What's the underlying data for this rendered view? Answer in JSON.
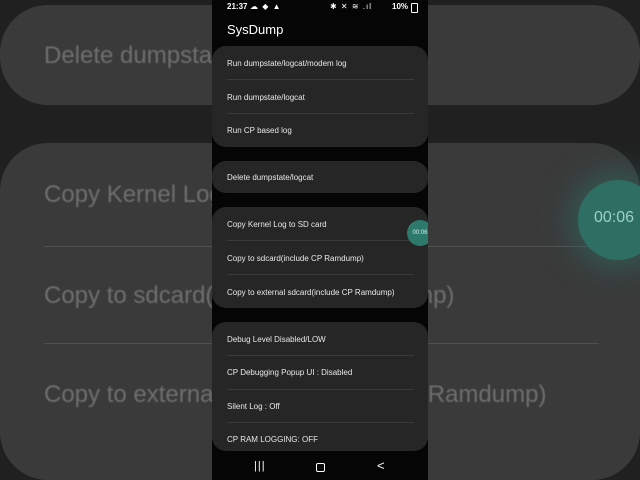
{
  "background": {
    "rows": [
      "Delete dumpstate/logcat",
      "Copy Kernel Log to SD card",
      "Copy to sdcard(include CP Ramdump)",
      "Copy to external sdcard(include CP Ramdump)"
    ],
    "timer": "00:06"
  },
  "status_bar": {
    "time": "21:37",
    "battery": "10%",
    "left_icons": "☁ ◆ ▲",
    "right_icons": "✱ ✕ ≋ .ıl"
  },
  "app": {
    "title": "SysDump",
    "sections": [
      {
        "items": [
          "Run dumpstate/logcat/modem log",
          "Run dumpstate/logcat",
          "Run CP based log"
        ]
      },
      {
        "items": [
          "Delete dumpstate/logcat"
        ]
      },
      {
        "items": [
          "Copy Kernel Log to SD card",
          "Copy to sdcard(include CP Ramdump)",
          "Copy to external sdcard(include CP Ramdump)"
        ]
      },
      {
        "items": [
          "Debug Level Disabled/LOW",
          "CP Debugging Popup UI : Disabled",
          "Silent Log : Off",
          "CP RAM LOGGING: OFF"
        ]
      }
    ],
    "timer": "00:06"
  },
  "nav_bar": {
    "recents_icon": "|||",
    "back_icon": "<"
  }
}
